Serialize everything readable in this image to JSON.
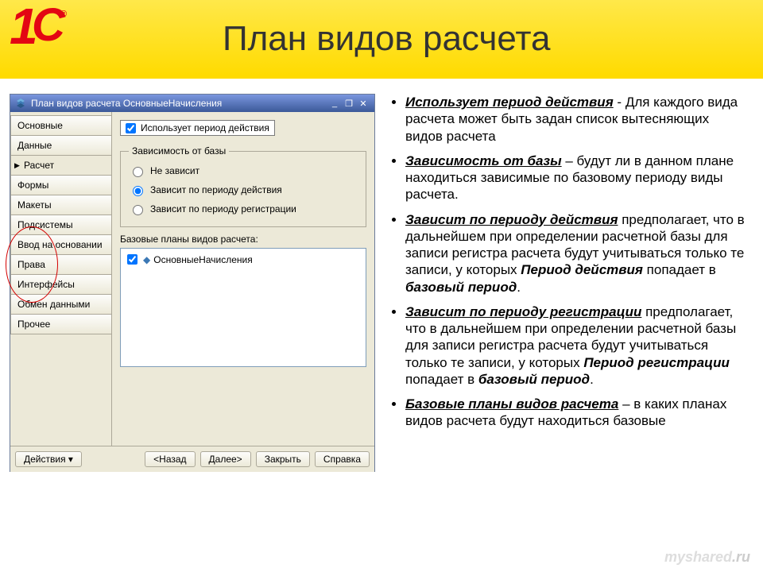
{
  "slide": {
    "title": "План видов расчета",
    "logo": {
      "one": "1",
      "c": "С",
      "reg": "®"
    },
    "watermark": {
      "a": "myshared",
      "b": ".ru"
    }
  },
  "window": {
    "title": "План видов расчета ОсновныеНачисления",
    "min": "_",
    "restore": "❐",
    "close": "✕",
    "tabs": [
      "Основные",
      "Данные",
      "Расчет",
      "Формы",
      "Макеты",
      "Подсистемы",
      "Ввод на основании",
      "Права",
      "Интерфейсы",
      "Обмен данными",
      "Прочее"
    ],
    "active_tab_index": 2,
    "checkbox_label": "Использует период действия",
    "group": {
      "legend": "Зависимость от базы",
      "options": [
        "Не зависит",
        "Зависит по периоду действия",
        "Зависит по периоду регистрации"
      ],
      "selected_index": 1
    },
    "listbox_label": "Базовые планы видов расчета:",
    "listbox_items": [
      "ОсновныеНачисления"
    ],
    "buttons": {
      "actions": "Действия ▾",
      "back": "<Назад",
      "next": "Далее>",
      "close": "Закрыть",
      "help": "Справка"
    }
  },
  "bullets": [
    {
      "term": "Использует период действия",
      "sep": " - ",
      "text": "Для каждого вида расчета может быть задан список вытесняющих видов расчета"
    },
    {
      "term": "Зависимость от базы",
      "sep": " – ",
      "text": "будут ли в данном плане находиться зависимые по базовому периоду виды расчета."
    },
    {
      "term": "Зависит по периоду действия",
      "sep": " ",
      "text_a": "предполагает, что в дальнейшем при определении расчетной базы для записи регистра расчета будут учитываться только те записи, у которых ",
      "em1": "Период действия",
      "text_b": " попадает в ",
      "em2": "базовый период",
      "tail": "."
    },
    {
      "term": "Зависит по периоду регистрации",
      "sep": " ",
      "text_a": "предполагает, что в дальнейшем при определении расчетной базы для записи регистра расчета будут учитываться только те записи, у которых ",
      "em1": "Период регистрации",
      "text_b": " попадает в ",
      "em2": "базовый период",
      "tail": "."
    },
    {
      "term": "Базовые планы видов расчета",
      "sep": " – ",
      "text": "в каких планах видов расчета будут находиться базовые"
    }
  ]
}
